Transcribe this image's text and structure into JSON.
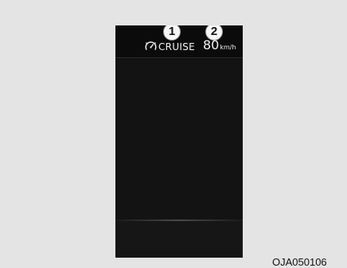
{
  "callouts": {
    "first": "1",
    "second": "2"
  },
  "cruise_indicator": {
    "icon": "cruise-control-icon",
    "label": "CRUISE"
  },
  "speed_setting": {
    "value": "80",
    "unit": "km/h"
  },
  "figure_code": "OJA050106",
  "colors": {
    "background": "#e4e4e4",
    "display": "#131313",
    "text": "#f2f2f2"
  }
}
